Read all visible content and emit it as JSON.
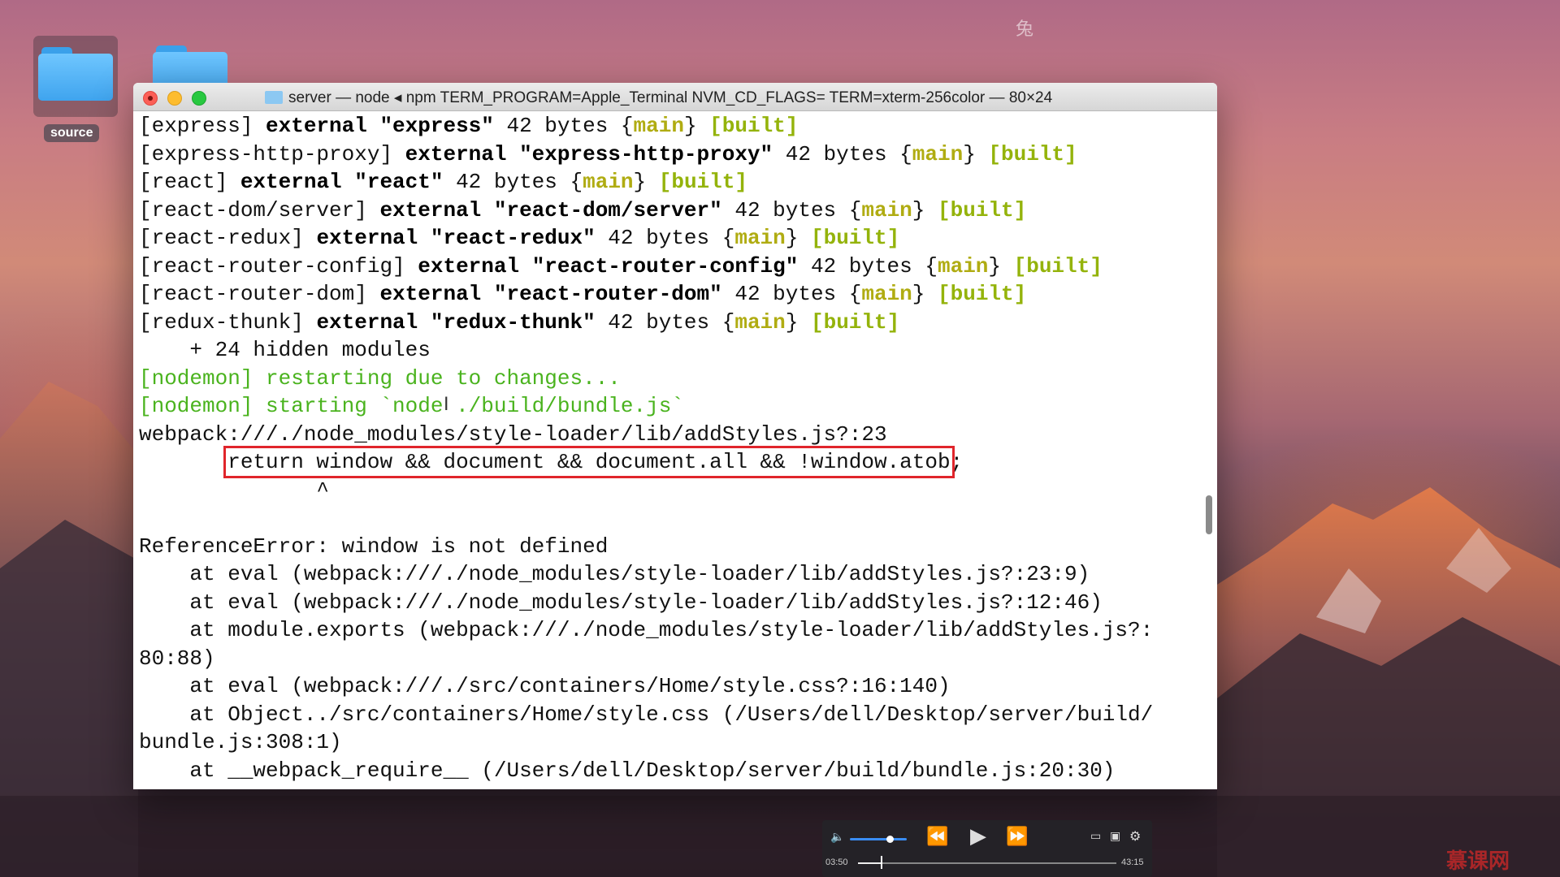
{
  "desktop": {
    "icons": [
      {
        "label": "source"
      }
    ],
    "watermark_top": "兔"
  },
  "window": {
    "title": "server — node ◂ npm TERM_PROGRAM=Apple_Terminal NVM_CD_FLAGS= TERM=xterm-256color — 80×24",
    "lines": [
      [
        [
          "[express] ",
          ""
        ],
        [
          "external \"express\"",
          "kw"
        ],
        [
          " 42 bytes {",
          ""
        ],
        [
          "main",
          "main"
        ],
        [
          "} ",
          ""
        ],
        [
          "[built]",
          "built"
        ]
      ],
      [
        [
          "[express-http-proxy] ",
          ""
        ],
        [
          "external \"express-http-proxy\"",
          "kw"
        ],
        [
          " 42 bytes {",
          ""
        ],
        [
          "main",
          "main"
        ],
        [
          "} ",
          ""
        ],
        [
          "[built]",
          "built"
        ]
      ],
      [
        [
          "[react] ",
          ""
        ],
        [
          "external \"react\"",
          "kw"
        ],
        [
          " 42 bytes {",
          ""
        ],
        [
          "main",
          "main"
        ],
        [
          "} ",
          ""
        ],
        [
          "[built]",
          "built"
        ]
      ],
      [
        [
          "[react-dom/server] ",
          ""
        ],
        [
          "external \"react-dom/server\"",
          "kw"
        ],
        [
          " 42 bytes {",
          ""
        ],
        [
          "main",
          "main"
        ],
        [
          "} ",
          ""
        ],
        [
          "[built]",
          "built"
        ]
      ],
      [
        [
          "[react-redux] ",
          ""
        ],
        [
          "external \"react-redux\"",
          "kw"
        ],
        [
          " 42 bytes {",
          ""
        ],
        [
          "main",
          "main"
        ],
        [
          "} ",
          ""
        ],
        [
          "[built]",
          "built"
        ]
      ],
      [
        [
          "[react-router-config] ",
          ""
        ],
        [
          "external \"react-router-config\"",
          "kw"
        ],
        [
          " 42 bytes {",
          ""
        ],
        [
          "main",
          "main"
        ],
        [
          "} ",
          ""
        ],
        [
          "[built]",
          "built"
        ]
      ],
      [
        [
          "[react-router-dom] ",
          ""
        ],
        [
          "external \"react-router-dom\"",
          "kw"
        ],
        [
          " 42 bytes {",
          ""
        ],
        [
          "main",
          "main"
        ],
        [
          "} ",
          ""
        ],
        [
          "[built]",
          "built"
        ]
      ],
      [
        [
          "[redux-thunk] ",
          ""
        ],
        [
          "external \"redux-thunk\"",
          "kw"
        ],
        [
          " 42 bytes {",
          ""
        ],
        [
          "main",
          "main"
        ],
        [
          "} ",
          ""
        ],
        [
          "[built]",
          "built"
        ]
      ],
      [
        [
          "    + 24 hidden modules",
          ""
        ]
      ],
      [
        [
          "[nodemon] restarting due to changes...",
          "green"
        ]
      ],
      [
        [
          "[nodemon] starting `node ./build/bundle.js`",
          "green"
        ]
      ],
      [
        [
          "webpack:///./node_modules/style-loader/lib/addStyles.js?:23",
          ""
        ]
      ],
      [
        [
          "       ",
          ""
        ],
        [
          "return window && document && document.all && !window.atob",
          "hl-box"
        ],
        [
          ";",
          ""
        ]
      ],
      [
        [
          "              ^",
          ""
        ]
      ],
      [
        [
          "",
          ""
        ]
      ],
      [
        [
          "ReferenceError: window is not defined",
          ""
        ]
      ],
      [
        [
          "    at eval (webpack:///./node_modules/style-loader/lib/addStyles.js?:23:9)",
          ""
        ]
      ],
      [
        [
          "    at eval (webpack:///./node_modules/style-loader/lib/addStyles.js?:12:46)",
          ""
        ]
      ],
      [
        [
          "    at module.exports (webpack:///./node_modules/style-loader/lib/addStyles.js?:",
          ""
        ]
      ],
      [
        [
          "80:88)",
          ""
        ]
      ],
      [
        [
          "    at eval (webpack:///./src/containers/Home/style.css?:16:140)",
          ""
        ]
      ],
      [
        [
          "    at Object../src/containers/Home/style.css (/Users/dell/Desktop/server/build/",
          ""
        ]
      ],
      [
        [
          "bundle.js:308:1)",
          ""
        ]
      ],
      [
        [
          "    at __webpack_require__ (/Users/dell/Desktop/server/build/bundle.js:20:30)",
          ""
        ]
      ]
    ]
  },
  "player": {
    "elapsed": "03:50",
    "total": "43:15",
    "progress": 0.089,
    "volume": 0.7,
    "icons": [
      "volume-icon",
      "rewind-icon",
      "play-icon",
      "fast-forward-icon",
      "subtitles-icon",
      "airplay-icon",
      "settings-icon"
    ]
  },
  "corner_watermark": "慕课网"
}
